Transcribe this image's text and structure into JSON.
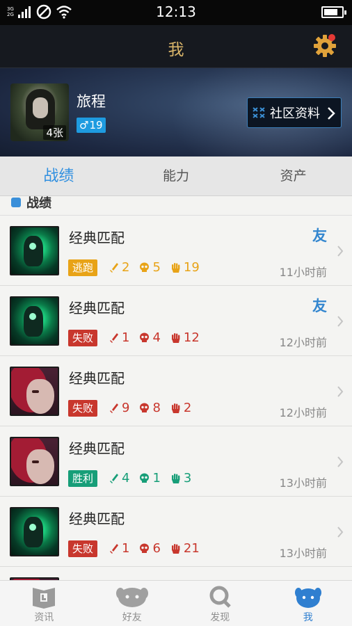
{
  "status_bar": {
    "time": "12:13",
    "network_top": "3G",
    "network_bottom": "2G",
    "battery_level": 0.8
  },
  "header": {
    "title": "我"
  },
  "profile": {
    "name": "旅程",
    "photo_count": "4张",
    "gender_symbol": "♂",
    "level": "19",
    "community_button": "社区资料"
  },
  "tabs": [
    {
      "label": "战绩",
      "active": true
    },
    {
      "label": "能力",
      "active": false
    },
    {
      "label": "资产",
      "active": false
    }
  ],
  "section_title": "战绩",
  "matches": [
    {
      "mode": "经典匹配",
      "friend": "友",
      "result": "逃跑",
      "result_color": "#e8a317",
      "kills": "2",
      "deaths": "5",
      "assists": "19",
      "stat_color": "#e8a317",
      "time": "11小时前",
      "champion": "green"
    },
    {
      "mode": "经典匹配",
      "friend": "友",
      "result": "失败",
      "result_color": "#c8372d",
      "kills": "1",
      "deaths": "4",
      "assists": "12",
      "stat_color": "#c8372d",
      "time": "12小时前",
      "champion": "green"
    },
    {
      "mode": "经典匹配",
      "friend": "",
      "result": "失败",
      "result_color": "#c8372d",
      "kills": "9",
      "deaths": "8",
      "assists": "2",
      "stat_color": "#c8372d",
      "time": "12小时前",
      "champion": "red"
    },
    {
      "mode": "经典匹配",
      "friend": "",
      "result": "胜利",
      "result_color": "#179e78",
      "kills": "4",
      "deaths": "1",
      "assists": "3",
      "stat_color": "#179e78",
      "time": "13小时前",
      "champion": "red"
    },
    {
      "mode": "经典匹配",
      "friend": "",
      "result": "失败",
      "result_color": "#c8372d",
      "kills": "1",
      "deaths": "6",
      "assists": "21",
      "stat_color": "#c8372d",
      "time": "13小时前",
      "champion": "green"
    },
    {
      "mode": "经典匹配",
      "friend": "",
      "result": "",
      "result_color": "#c8372d",
      "kills": "",
      "deaths": "",
      "assists": "",
      "stat_color": "#c8372d",
      "time": "",
      "champion": "red"
    }
  ],
  "bottom_nav": [
    {
      "label": "资讯",
      "icon": "news-icon",
      "active": false
    },
    {
      "label": "好友",
      "icon": "friends-icon",
      "active": false
    },
    {
      "label": "发现",
      "icon": "discover-icon",
      "active": false
    },
    {
      "label": "我",
      "icon": "me-icon",
      "active": true
    }
  ],
  "colors": {
    "accent": "#2f8fe0",
    "title_gold": "#d9b56a",
    "friend_blue": "#3386cf"
  }
}
